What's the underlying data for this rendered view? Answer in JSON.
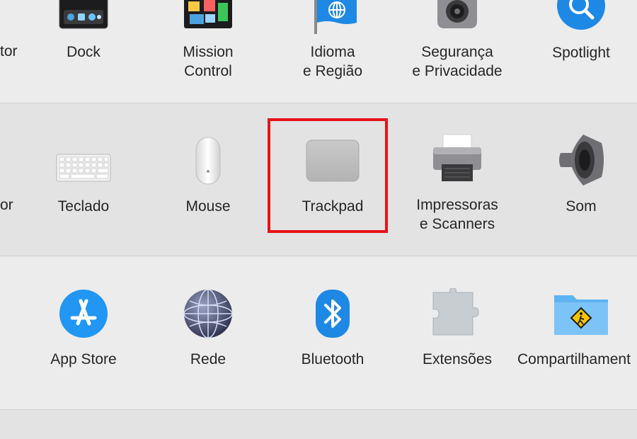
{
  "row1": {
    "cut_label": "tor",
    "items": [
      {
        "label": "Dock"
      },
      {
        "label_line1": "Mission",
        "label_line2": "Control"
      },
      {
        "label_line1": "Idioma",
        "label_line2": "e Região"
      },
      {
        "label_line1": "Segurança",
        "label_line2": "e Privacidade"
      },
      {
        "label": "Spotlight"
      }
    ]
  },
  "row2": {
    "cut_label": "or",
    "items": [
      {
        "label": "Teclado"
      },
      {
        "label": "Mouse"
      },
      {
        "label": "Trackpad"
      },
      {
        "label_line1": "Impressoras",
        "label_line2": "e Scanners"
      },
      {
        "label": "Som"
      }
    ]
  },
  "row3": {
    "items": [
      {
        "label": "App Store"
      },
      {
        "label": "Rede"
      },
      {
        "label": "Bluetooth"
      },
      {
        "label": "Extensões"
      },
      {
        "label": "Compartilhament"
      }
    ]
  },
  "highlight_color": "#e8131a"
}
